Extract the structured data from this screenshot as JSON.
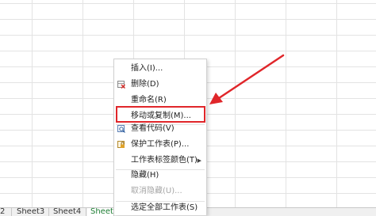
{
  "sheet_tabs": [
    "2",
    "Sheet3",
    "Sheet4",
    "Sheet"
  ],
  "context_menu": {
    "items": [
      {
        "label": "插入(I)...",
        "icon": "",
        "disabled": false
      },
      {
        "label": "删除(D)",
        "icon": "delete-sheet-icon",
        "disabled": false
      },
      {
        "label": "重命名(R)",
        "icon": "",
        "disabled": false
      },
      {
        "label": "移动或复制(M)...",
        "icon": "",
        "disabled": false
      },
      {
        "label": "查看代码(V)",
        "icon": "view-code-icon",
        "disabled": false
      },
      {
        "label": "保护工作表(P)...",
        "icon": "protect-sheet-icon",
        "disabled": false
      },
      {
        "label": "工作表标签颜色(T)",
        "icon": "",
        "disabled": false,
        "submenu": true
      },
      {
        "label": "隐藏(H)",
        "icon": "",
        "disabled": false
      },
      {
        "label": "取消隐藏(U)...",
        "icon": "",
        "disabled": true
      },
      {
        "label": "选定全部工作表(S)",
        "icon": "",
        "disabled": false
      }
    ]
  },
  "annotation": {
    "color": "#e0262a"
  }
}
